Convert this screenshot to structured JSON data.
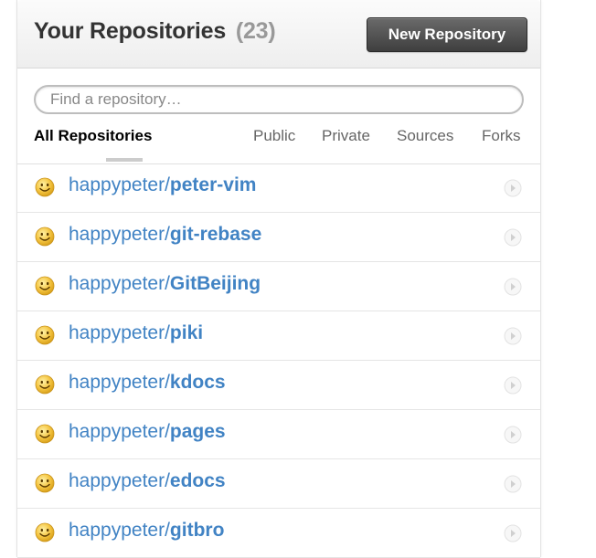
{
  "header": {
    "title": "Your Repositories",
    "count": "(23)",
    "new_button_label": "New Repository"
  },
  "search": {
    "placeholder": "Find a repository…",
    "value": ""
  },
  "filters": {
    "all": "All Repositories",
    "public": "Public",
    "private": "Private",
    "sources": "Sources",
    "forks": "Forks",
    "selected": "All Repositories"
  },
  "repositories": [
    {
      "owner": "happypeter/",
      "name": "peter-vim"
    },
    {
      "owner": "happypeter/",
      "name": "git-rebase"
    },
    {
      "owner": "happypeter/",
      "name": "GitBeijing"
    },
    {
      "owner": "happypeter/",
      "name": "piki"
    },
    {
      "owner": "happypeter/",
      "name": "kdocs"
    },
    {
      "owner": "happypeter/",
      "name": "pages"
    },
    {
      "owner": "happypeter/",
      "name": "edocs"
    },
    {
      "owner": "happypeter/",
      "name": "gitbro"
    }
  ],
  "icons": {
    "repo_icon": "smiley-icon",
    "row_arrow": "chevron-right-icon"
  },
  "colors": {
    "link": "#4183c4",
    "smiley": "#f5c542",
    "button_bg": "#4a4a4a"
  }
}
